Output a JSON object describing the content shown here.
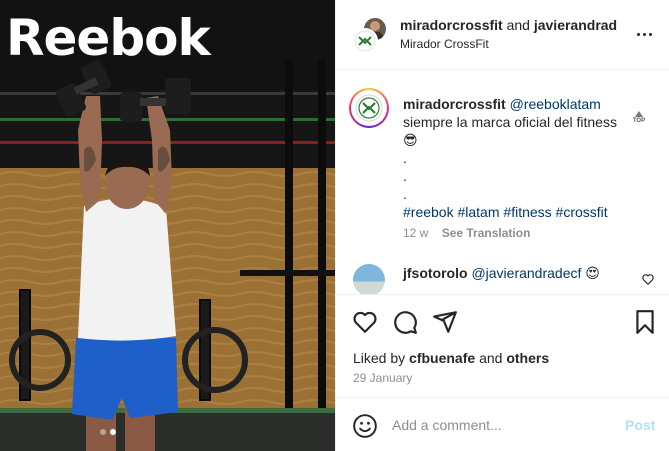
{
  "photo": {
    "logo_text": "Reebok",
    "carousel_dots": 2,
    "active_dot": 2,
    "top_badge": "TOP"
  },
  "header": {
    "username": "miradorcrossfit",
    "conjunction": "and",
    "coauthor": "javierandrad",
    "location": "Mirador CrossFit",
    "more_icon": "ellipsis-icon"
  },
  "caption": {
    "username": "miradorcrossfit",
    "mention": "@reeboklatam",
    "text": "siempre la marca oficial del fitness",
    "emoji": "😎",
    "dot_lines": [
      ".",
      ".",
      "."
    ],
    "hashtags": [
      "#reebok",
      "#latam",
      "#fitness",
      "#crossfit"
    ],
    "age": "12 w",
    "translate": "See Translation"
  },
  "comment": {
    "username": "jfsotorolo",
    "mention": "@javierandradecf",
    "emoji": "😍"
  },
  "actions": {
    "icons": [
      "heart-icon",
      "comment-icon",
      "share-icon",
      "bookmark-icon"
    ],
    "liked_prefix": "Liked by",
    "liked_user": "cfbuenafe",
    "liked_and": "and",
    "liked_others": "others",
    "date": "29 January"
  },
  "add_comment": {
    "placeholder": "Add a comment...",
    "post_label": "Post"
  },
  "colors": {
    "link": "#00376b",
    "muted": "#8e8e8e",
    "post_disabled": "#b2dffc",
    "border": "#efefef"
  }
}
